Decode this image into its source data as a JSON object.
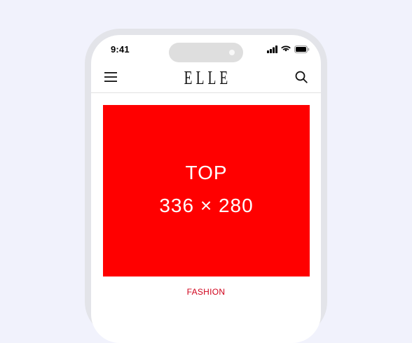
{
  "status_bar": {
    "time": "9:41",
    "icons": [
      "signal-icon",
      "wifi-icon",
      "battery-icon"
    ]
  },
  "header": {
    "menu_icon": "hamburger-menu-icon",
    "logo": "ELLE",
    "search_icon": "search-icon"
  },
  "ad": {
    "title": "TOP",
    "size": "336 × 280",
    "background": "#ff0000"
  },
  "content": {
    "category": "FASHION"
  },
  "colors": {
    "page_background": "#f1f2fc",
    "phone_frame": "#e3e4e9",
    "accent": "#d0021b"
  }
}
